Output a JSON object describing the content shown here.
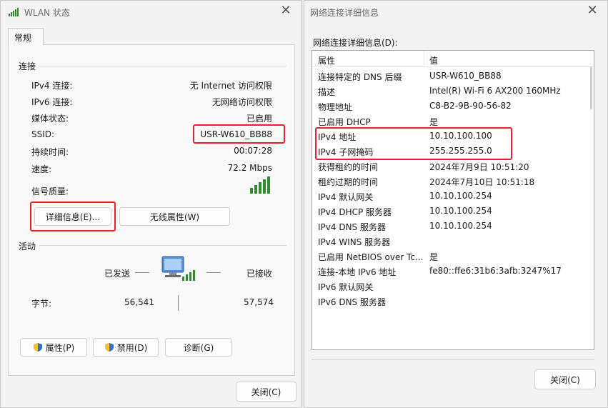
{
  "status_window": {
    "title": "WLAN 状态",
    "tab": "常规",
    "connection_section": "连接",
    "rows": [
      {
        "label": "IPv4 连接:",
        "value": "无 Internet 访问权限"
      },
      {
        "label": "IPv6 连接:",
        "value": "无网络访问权限"
      },
      {
        "label": "媒体状态:",
        "value": "已启用"
      },
      {
        "label": "SSID:",
        "value": "USR-W610_BB88"
      },
      {
        "label": "持续时间:",
        "value": "00:07:28"
      },
      {
        "label": "速度:",
        "value": "72.2 Mbps"
      }
    ],
    "signal_label": "信号质量:",
    "details_button": "详细信息(E)...",
    "wireless_props_button": "无线属性(W)",
    "activity_section": "活动",
    "sent_label": "已发送",
    "received_label": "已接收",
    "bytes_label": "字节:",
    "bytes_sent": "56,541",
    "bytes_received": "57,574",
    "properties_button": "属性(P)",
    "disable_button": "禁用(D)",
    "diagnose_button": "诊断(G)",
    "close_button": "关闭(C)"
  },
  "details_window": {
    "title": "网络连接详细信息",
    "list_label": "网络连接详细信息(D):",
    "col_property": "属性",
    "col_value": "值",
    "rows": [
      {
        "prop": "连接特定的 DNS 后缀",
        "val": "USR-W610_BB88"
      },
      {
        "prop": "描述",
        "val": "Intel(R) Wi-Fi 6 AX200 160MHz"
      },
      {
        "prop": "物理地址",
        "val": "C8-B2-9B-90-56-82"
      },
      {
        "prop": "已启用 DHCP",
        "val": "是"
      },
      {
        "prop": "IPv4 地址",
        "val": "10.10.100.100"
      },
      {
        "prop": "IPv4 子网掩码",
        "val": "255.255.255.0"
      },
      {
        "prop": "获得租约的时间",
        "val": "2024年7月9日 10:51:20"
      },
      {
        "prop": "租约过期的时间",
        "val": "2024年7月10日 10:51:18"
      },
      {
        "prop": "IPv4 默认网关",
        "val": "10.10.100.254"
      },
      {
        "prop": "IPv4 DHCP 服务器",
        "val": "10.10.100.254"
      },
      {
        "prop": "IPv4 DNS 服务器",
        "val": "10.10.100.254"
      },
      {
        "prop": "IPv4 WINS 服务器",
        "val": ""
      },
      {
        "prop": "已启用 NetBIOS over Tc...",
        "val": "是"
      },
      {
        "prop": "连接-本地 IPv6 地址",
        "val": "fe80::ffe6:31b6:3afb:3247%17"
      },
      {
        "prop": "IPv6 默认网关",
        "val": ""
      },
      {
        "prop": "IPv6 DNS 服务器",
        "val": ""
      }
    ],
    "close_button": "关闭(C)"
  },
  "icons": {
    "close": "close-icon",
    "wifi": "wifi-signal-icon",
    "shield": "uac-shield-icon",
    "network_pc": "network-computer-icon"
  },
  "colors": {
    "highlight": "#e3242b",
    "signal": "#2e8b2e"
  }
}
